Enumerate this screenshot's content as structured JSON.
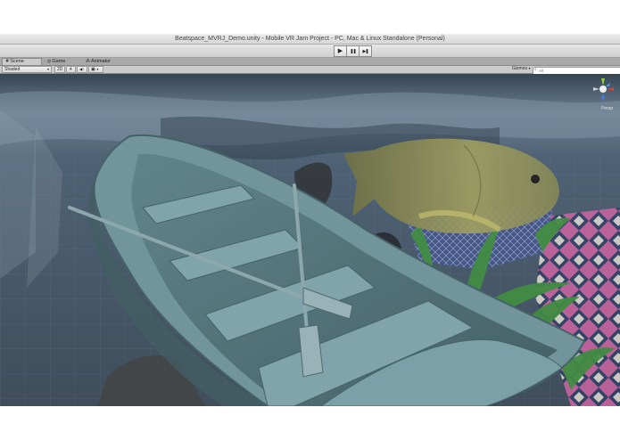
{
  "window": {
    "title": "Beatspace_MVRJ_Demo.unity - Mobile VR Jam Project - PC, Mac & Linux Standalone (Personal)"
  },
  "toolbar": {
    "play_icon": "play-icon",
    "pause_icon": "pause-icon",
    "step_icon": "step-icon",
    "play_glyph": "▶",
    "pause_glyph": "❚❚",
    "step_glyph": "▶❚"
  },
  "tabs": [
    {
      "label": "Scene",
      "icon": "scene-icon",
      "glyph": "#",
      "active": true
    },
    {
      "label": "Game",
      "icon": "game-icon",
      "glyph": "◎",
      "active": false
    },
    {
      "label": "Animator",
      "icon": "animator-icon",
      "glyph": "⁂",
      "active": false
    }
  ],
  "scene_toolbar": {
    "render_mode": "Shaded",
    "mode_2d": "2D",
    "lighting_glyph": "☀",
    "audio_glyph": "◀)",
    "effects_glyph": "▣",
    "gizmos_label": "Gizmos",
    "search_placeholder": "All"
  },
  "viewport": {
    "gizmo_label": "Persp",
    "colors": {
      "water": "#5f7384",
      "deep": "#3b4a58",
      "boat": "#6f949a",
      "boat_dark": "#425e64",
      "fish": "#9a9a55",
      "plant": "#3c8a3a",
      "rug_pink": "#c0508a"
    }
  }
}
